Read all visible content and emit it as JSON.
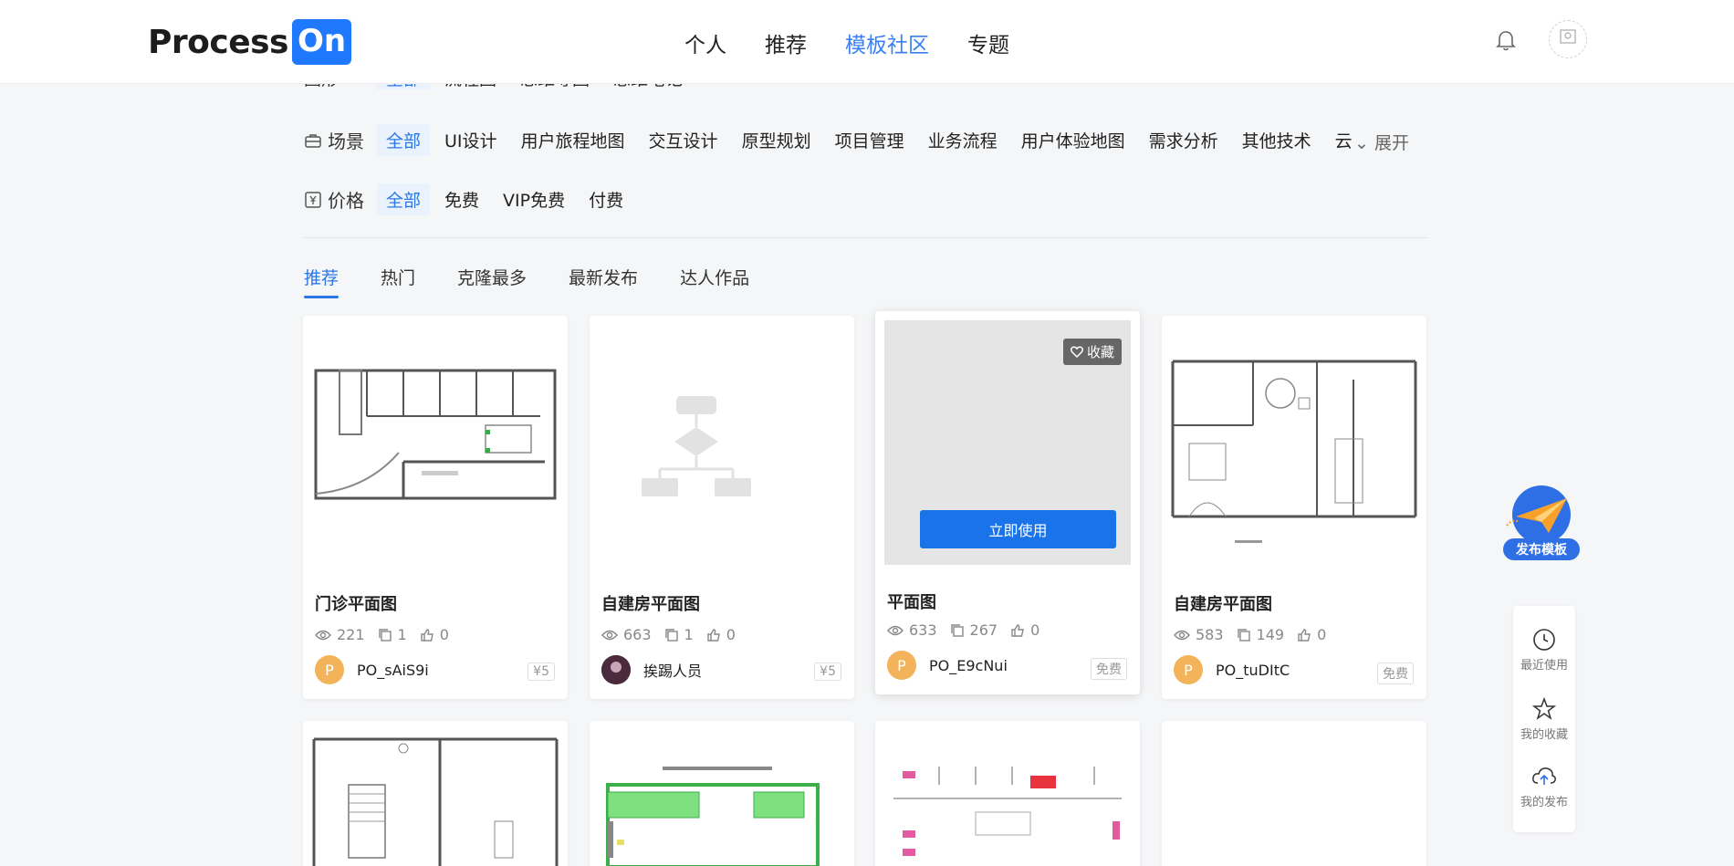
{
  "header": {
    "logo": {
      "text": "Process",
      "box": "On"
    },
    "nav": [
      "个人",
      "推荐",
      "模板社区",
      "专题"
    ],
    "active_nav": "模板社区"
  },
  "filters": {
    "hidden_row": {
      "label": "图形",
      "chips": [
        "全部",
        "流程图",
        "思维导图",
        "思维笔记"
      ]
    },
    "scene": {
      "label": "场景",
      "chips": [
        "全部",
        "UI设计",
        "用户旅程地图",
        "交互设计",
        "原型规划",
        "项目管理",
        "业务流程",
        "用户体验地图",
        "需求分析",
        "其他技术",
        "云"
      ],
      "expand": "展开"
    },
    "price": {
      "label": "价格",
      "chips": [
        "全部",
        "免费",
        "VIP免费",
        "付费"
      ]
    }
  },
  "sort_tabs": [
    "推荐",
    "热门",
    "克隆最多",
    "最新发布",
    "达人作品"
  ],
  "cards": [
    {
      "title": "门诊平面图",
      "views": "221",
      "clones": "1",
      "likes": "0",
      "author": "PO_sAiS9i",
      "avatar": "P",
      "price": "¥5"
    },
    {
      "title": "自建房平面图",
      "views": "663",
      "clones": "1",
      "likes": "0",
      "author": "挨踢人员",
      "avatar": "",
      "price": "¥5"
    },
    {
      "title": "平面图",
      "views": "633",
      "clones": "267",
      "likes": "0",
      "author": "PO_E9cNui",
      "avatar": "P",
      "price": "免费",
      "use_button": "立即使用",
      "fav_button": "收藏"
    },
    {
      "title": "自建房平面图",
      "views": "583",
      "clones": "149",
      "likes": "0",
      "author": "PO_tuDItC",
      "avatar": "P",
      "price": "免费"
    }
  ],
  "floating": {
    "publish": "发布模板",
    "recent": "最近使用",
    "favorites": "我的收藏",
    "published": "我的发布"
  },
  "colors": {
    "accent": "#2c77e6",
    "button": "#1a73e8",
    "avatar": "#f2b35a"
  },
  "icons": [
    "bell-icon",
    "eye-icon",
    "copy-icon",
    "like-icon",
    "heart-icon",
    "clock-icon",
    "star-icon",
    "cloud-upload-icon",
    "paper-plane-icon"
  ]
}
